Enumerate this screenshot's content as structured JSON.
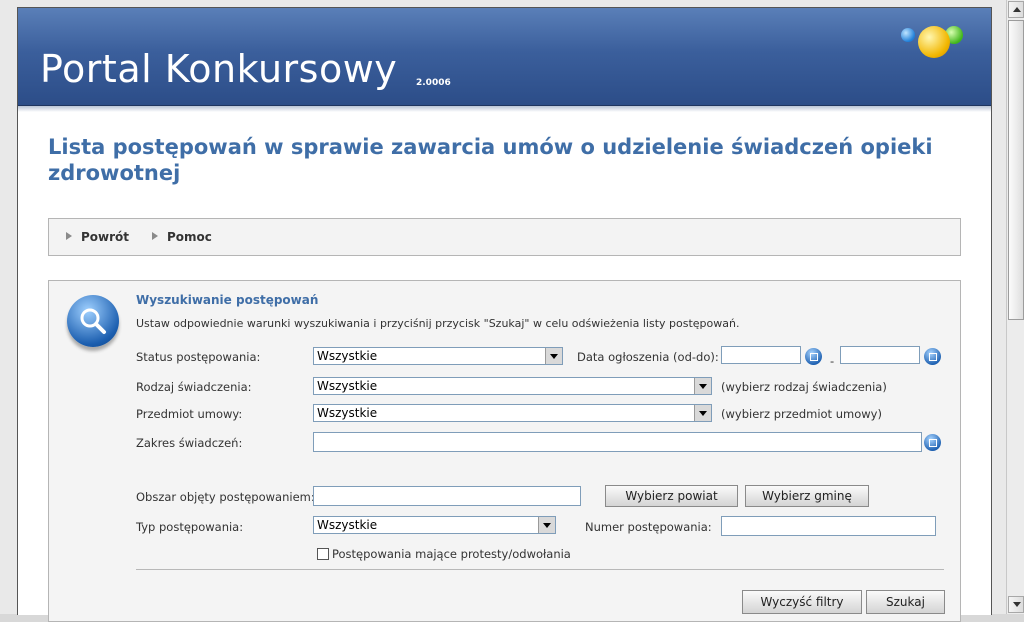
{
  "header": {
    "app_title": "Portal Konkursowy",
    "version": "2.0006"
  },
  "page_title": "Lista postępowań w sprawie zawarcia umów o udzielenie świadczeń opieki zdrowotnej",
  "toolbar": {
    "back_label": "Powrót",
    "help_label": "Pomoc"
  },
  "search": {
    "title": "Wyszukiwanie postępowań",
    "description": "Ustaw odpowiednie warunki wyszukiwania i przyciśnij przycisk \"Szukaj\" w celu odświeżenia listy postępowań.",
    "status_label": "Status postępowania:",
    "status_value": "Wszystkie",
    "date_label": "Data ogłoszenia (od-do):",
    "date_separator": "-",
    "date_from": "",
    "date_to": "",
    "service_type_label": "Rodzaj świadczenia:",
    "service_type_value": "Wszystkie",
    "service_type_hint": "(wybierz rodzaj świadczenia)",
    "subject_label": "Przedmiot umowy:",
    "subject_value": "Wszystkie",
    "subject_hint": "(wybierz przedmiot umowy)",
    "scope_label": "Zakres świadczeń:",
    "scope_value": "",
    "area_label": "Obszar objęty postępowaniem:",
    "area_value": "",
    "choose_county_label": "Wybierz powiat",
    "choose_commune_label": "Wybierz gminę",
    "type_label": "Typ postępowania:",
    "type_value": "Wszystkie",
    "number_label": "Numer postępowania:",
    "number_value": "",
    "protests_label": "Postępowania mające protesty/odwołania",
    "clear_label": "Wyczyść filtry",
    "search_label": "Szukaj"
  }
}
